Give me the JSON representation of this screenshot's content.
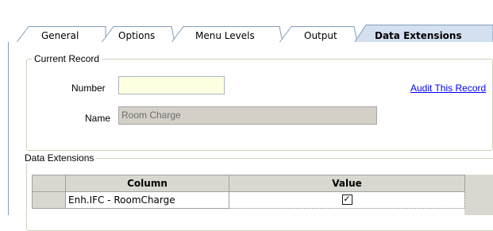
{
  "tabs": [
    {
      "label": "General"
    },
    {
      "label": "Options"
    },
    {
      "label": "Menu Levels"
    },
    {
      "label": "Output"
    },
    {
      "label": "Data Extensions",
      "active": true
    }
  ],
  "current_record": {
    "title": "Current Record",
    "number_label": "Number",
    "number_value": "",
    "name_label": "Name",
    "name_value": "Room Charge",
    "audit_link": "Audit This Record"
  },
  "data_extensions": {
    "title": "Data Extensions",
    "columns": [
      "Column",
      "Value"
    ],
    "rows": [
      {
        "column": "Enh.IFC - RoomCharge",
        "value_checked": true,
        "check_glyph": "✓"
      }
    ]
  },
  "colors": {
    "tab_border": "#7f9db9",
    "active_tab": "#d4e0f0",
    "number_field_bg": "#ffffe1",
    "name_field_bg": "#d4d0c8",
    "link": "#0000ff"
  }
}
